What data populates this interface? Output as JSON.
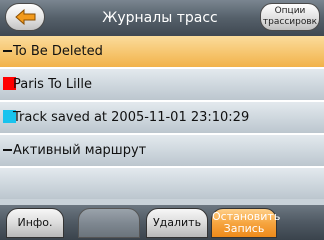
{
  "header": {
    "title": "Журналы трасс",
    "back_icon": "back-arrow-icon",
    "options_line1": "Опции",
    "options_line2": "трассировк"
  },
  "list": {
    "items": [
      {
        "label": "To Be Deleted",
        "marker": "dash",
        "color": "#111111",
        "selected": true
      },
      {
        "label": "Paris To Lille",
        "marker": "box",
        "color": "#ff0000",
        "selected": false
      },
      {
        "label": "Track saved at 2005-11-01 23:10:29",
        "marker": "box",
        "color": "#19c3ee",
        "selected": false
      },
      {
        "label": "Активный маршрут",
        "marker": "dash",
        "color": "#111111",
        "selected": false
      }
    ]
  },
  "bottombar": {
    "info_label": "Инфо.",
    "blank_label": "",
    "delete_label": "Удалить",
    "stop_line1": "Остановить",
    "stop_line2": "Запись"
  },
  "colors": {
    "selected_row": "#f6c56e",
    "accent_orange": "#f6a540"
  }
}
